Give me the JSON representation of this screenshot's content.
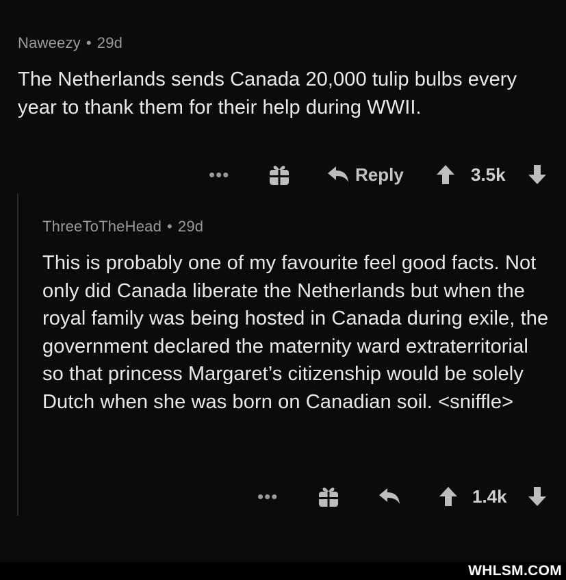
{
  "parent_comment": {
    "author": "Naweezy",
    "separator": "•",
    "age": "29d",
    "text": "The Netherlands sends Canada 20,000 tulip bulbs every year to thank them for their help during WWII.",
    "more_label": "•••",
    "reply_label": "Reply",
    "score": "3.5k"
  },
  "child_comment": {
    "author": "ThreeToTheHead",
    "separator": "•",
    "age": "29d",
    "text": "This is probably one of my favourite feel good facts. Not only did Canada liberate the Netherlands but when the royal family was being hosted in Canada during exile, the government declared the maternity ward extraterritorial so that princess Margaret’s citizenship would be solely Dutch when she was born on Canadian soil. <sniffle>",
    "more_label": "•••",
    "score": "1.4k"
  },
  "icons": {
    "more": "more-options-icon",
    "gift": "gift-award-icon",
    "reply": "reply-arrow-icon",
    "upvote": "upvote-arrow-icon",
    "downvote": "downvote-arrow-icon"
  },
  "watermark": "WHLSM.COM",
  "colors": {
    "background": "#0b0b0b",
    "text": "#e9e9e9",
    "meta": "#9a9a9a",
    "icon": "#bdbdbd"
  }
}
